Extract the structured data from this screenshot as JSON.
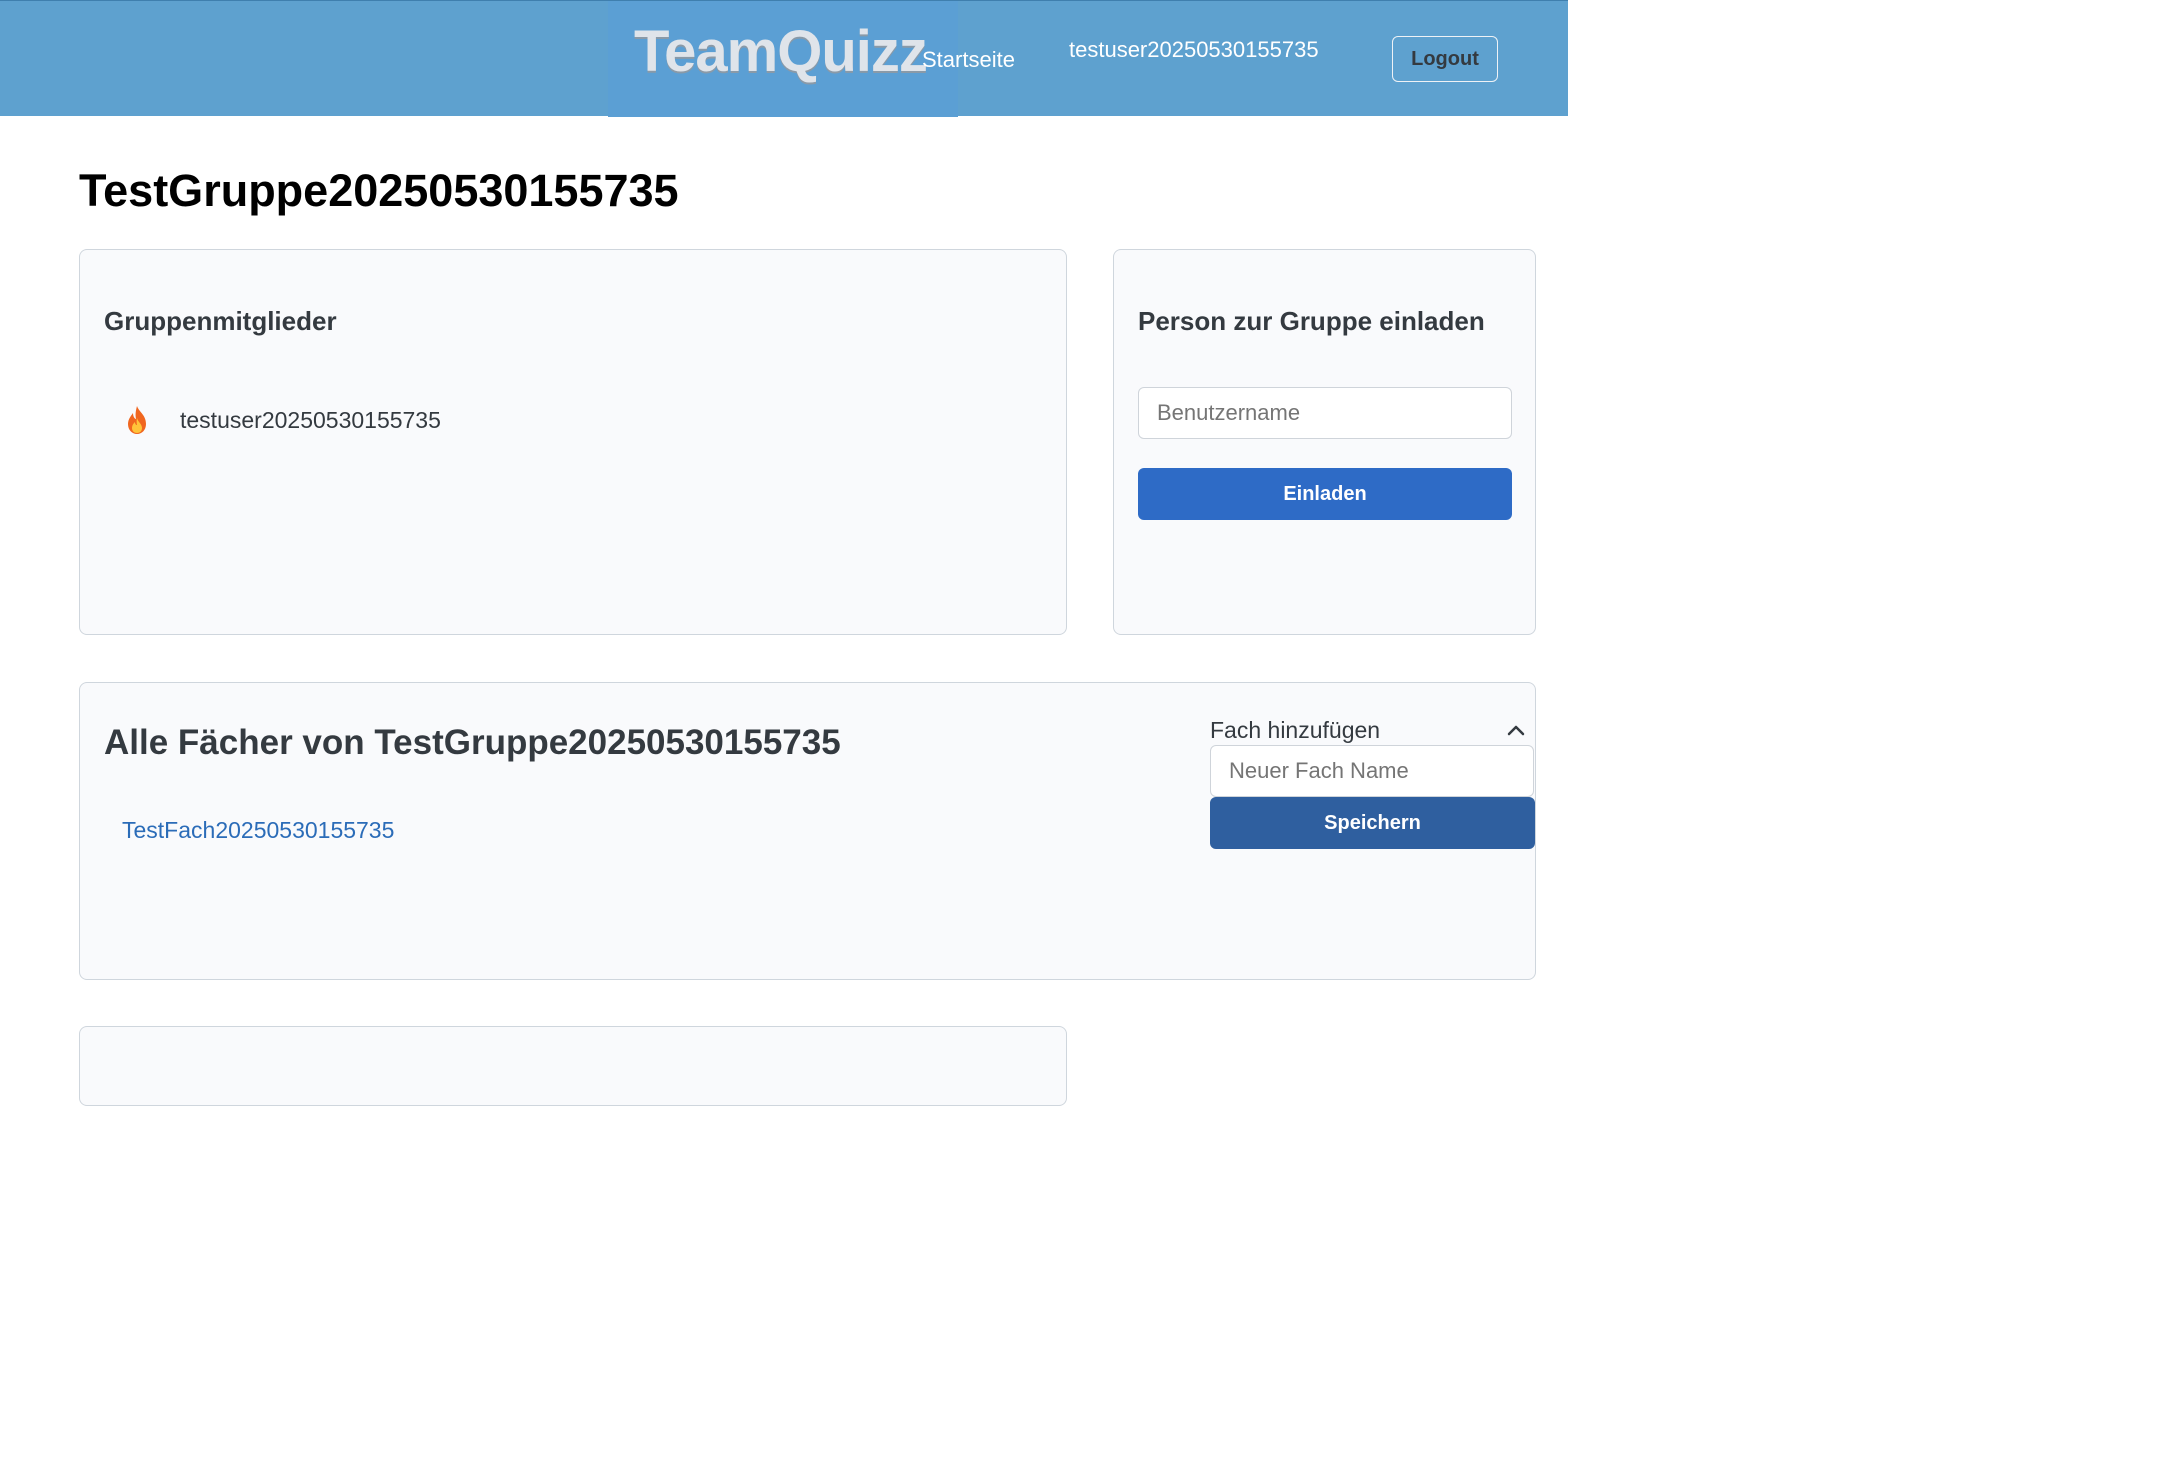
{
  "navbar": {
    "brand": "TeamQuizz",
    "home_label": "Startseite",
    "username": "testuser20250530155735",
    "logout_label": "Logout"
  },
  "page": {
    "title": "TestGruppe20250530155735"
  },
  "members": {
    "title": "Gruppenmitglieder",
    "items": [
      {
        "icon": "fire-icon",
        "name": "testuser20250530155735"
      }
    ]
  },
  "invite": {
    "title": "Person zur Gruppe einladen",
    "input_placeholder": "Benutzername",
    "button_label": "Einladen"
  },
  "subjects": {
    "title": "Alle Fächer von TestGruppe20250530155735",
    "items": [
      "TestFach20250530155735"
    ],
    "add_label": "Fach hinzufügen",
    "add_expanded": true,
    "input_placeholder": "Neuer Fach Name",
    "save_label": "Speichern"
  },
  "colors": {
    "navbar": "#5ea1cf",
    "primary_button": "#2e6bc6",
    "save_button": "#2f5f9f",
    "link": "#2b6cb8",
    "card_background": "#f9fafc"
  }
}
